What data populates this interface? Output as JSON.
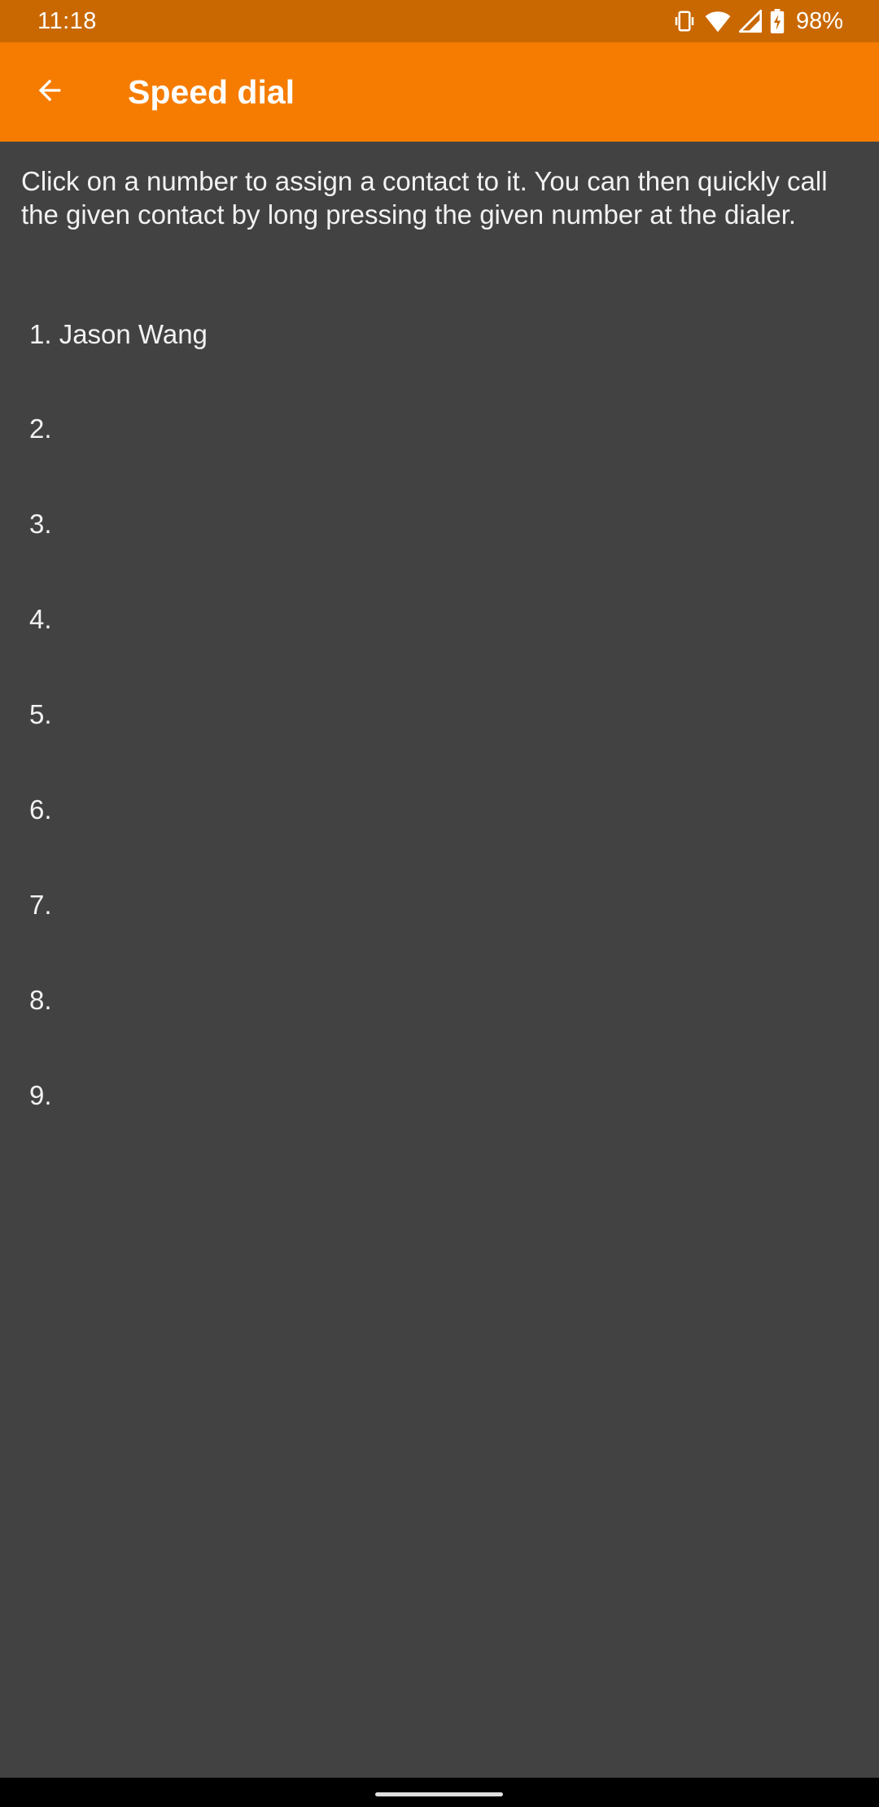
{
  "status_bar": {
    "time": "11:18",
    "battery": "98%",
    "icons": [
      "vibrate-icon",
      "wifi-icon",
      "signal-icon",
      "battery-charging-icon"
    ]
  },
  "app_bar": {
    "title": "Speed dial",
    "back_icon": "arrow-back-icon"
  },
  "description": "Click on a number to assign a contact to it. You can then quickly call the given contact by long pressing the given number at the dialer.",
  "speed_dial": [
    {
      "label": "1. Jason Wang"
    },
    {
      "label": "2."
    },
    {
      "label": "3."
    },
    {
      "label": "4."
    },
    {
      "label": "5."
    },
    {
      "label": "6."
    },
    {
      "label": "7."
    },
    {
      "label": "8."
    },
    {
      "label": "9."
    }
  ],
  "colors": {
    "status_bar": "#c96800",
    "app_bar": "#f57c00",
    "background": "#424242",
    "text": "#f2f2f2"
  }
}
